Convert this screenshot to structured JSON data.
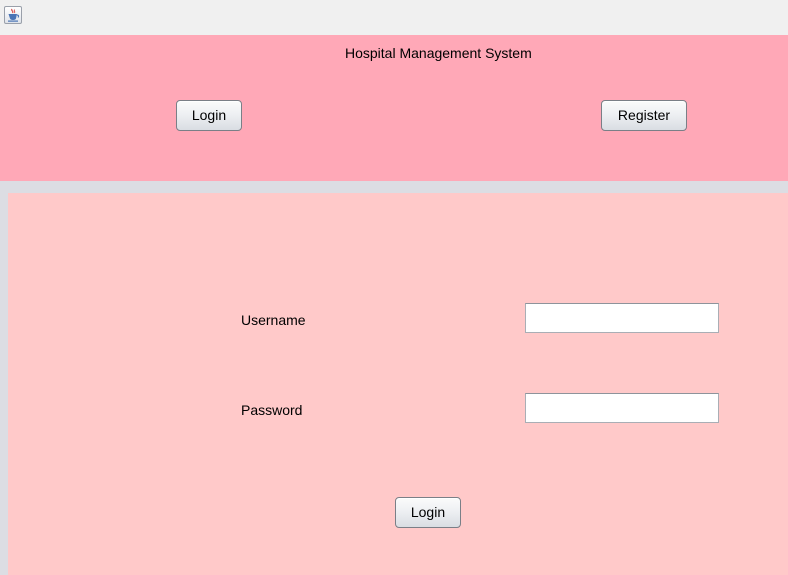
{
  "window": {
    "icon": "java-cup-icon"
  },
  "header": {
    "title": "Hospital Management System",
    "login_label": "Login",
    "register_label": "Register",
    "background": "#ffa8b7"
  },
  "login_form": {
    "username_label": "Username",
    "username_value": "",
    "password_label": "Password",
    "password_value": "",
    "submit_label": "Login",
    "background": "#ffc9c9"
  }
}
